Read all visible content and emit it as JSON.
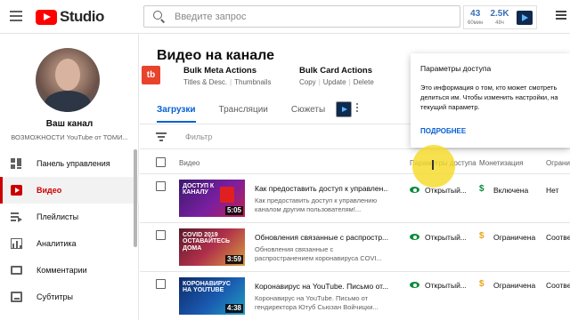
{
  "header": {
    "logo_text": "Studio",
    "search_placeholder": "Введите запрос",
    "stats": [
      {
        "value": "43",
        "label": "60мин"
      },
      {
        "value": "2.5K",
        "label": "48ч"
      }
    ]
  },
  "sidebar": {
    "channel_title": "Ваш канал",
    "channel_subtitle": "ВОЗМОЖНОСТИ YouTube от ТОМИ...",
    "items": [
      {
        "label": "Панель управления",
        "icon": "dashboard-icon",
        "active": false
      },
      {
        "label": "Видео",
        "icon": "video-icon",
        "active": true
      },
      {
        "label": "Плейлисты",
        "icon": "playlist-icon",
        "active": false
      },
      {
        "label": "Аналитика",
        "icon": "analytics-icon",
        "active": false
      },
      {
        "label": "Комментарии",
        "icon": "comments-icon",
        "active": false
      },
      {
        "label": "Субтитры",
        "icon": "subtitles-icon",
        "active": false
      }
    ]
  },
  "main": {
    "title": "Видео на канале",
    "extension_logo": "tb",
    "bulk": [
      {
        "title": "Bulk Meta Actions",
        "links": [
          "Titles & Desc.",
          "Thumbnails"
        ]
      },
      {
        "title": "Bulk Card Actions",
        "links": [
          "Copy",
          "Update",
          "Delete"
        ]
      }
    ],
    "tabs": [
      {
        "label": "Загрузки",
        "active": true
      },
      {
        "label": "Трансляции",
        "active": false
      },
      {
        "label": "Сюжеты",
        "active": false
      }
    ],
    "filter_label": "Фильтр",
    "columns": {
      "video": "Видео",
      "visibility": "Параметры доступа",
      "monetization": "Монетизация",
      "restrictions": "Ограни"
    },
    "rows": [
      {
        "thumb_text": "ДОСТУП К КАНАЛУ",
        "duration": "5:05",
        "title": "Как предоставить доступ к управлен...",
        "desc": "Как предоставить доступ к управлению каналом другим пользователям!...",
        "visibility": "Открытый...",
        "monetization": "Включена",
        "monetization_color": "#0a8a3a",
        "restrictions": "Нет"
      },
      {
        "thumb_text": "COVID 2019 ОСТАВАЙТЕСЬ ДОМА",
        "duration": "3:59",
        "title": "Обновления связанные с распростр...",
        "desc": "Обновления связанные с распространением коронавируса COVI...",
        "visibility": "Открытый...",
        "monetization": "Ограничена",
        "monetization_color": "#e8a317",
        "restrictions": "Соотве"
      },
      {
        "thumb_text": "КОРОНАВИРУС НА YOUTUBE",
        "duration": "4:38",
        "title": "Коронавирус на YouTube. Письмо от...",
        "desc": "Коронавирус на YouTube. Письмо от гендиректора Ютуб Сьюзан Войчицки...",
        "visibility": "Открытый...",
        "monetization": "Ограничена",
        "monetization_color": "#e8a317",
        "restrictions": "Соотве"
      }
    ]
  },
  "popup": {
    "title": "Параметры доступа",
    "body": "Это информация о том, кто может смотреть делиться им. Чтобы изменить настройки, на текущий параметр.",
    "link": "ПОДРОБНЕЕ"
  },
  "colors": {
    "accent_red": "#cc0000",
    "link_blue": "#065fd4",
    "highlight_yellow": "#f5da28"
  }
}
